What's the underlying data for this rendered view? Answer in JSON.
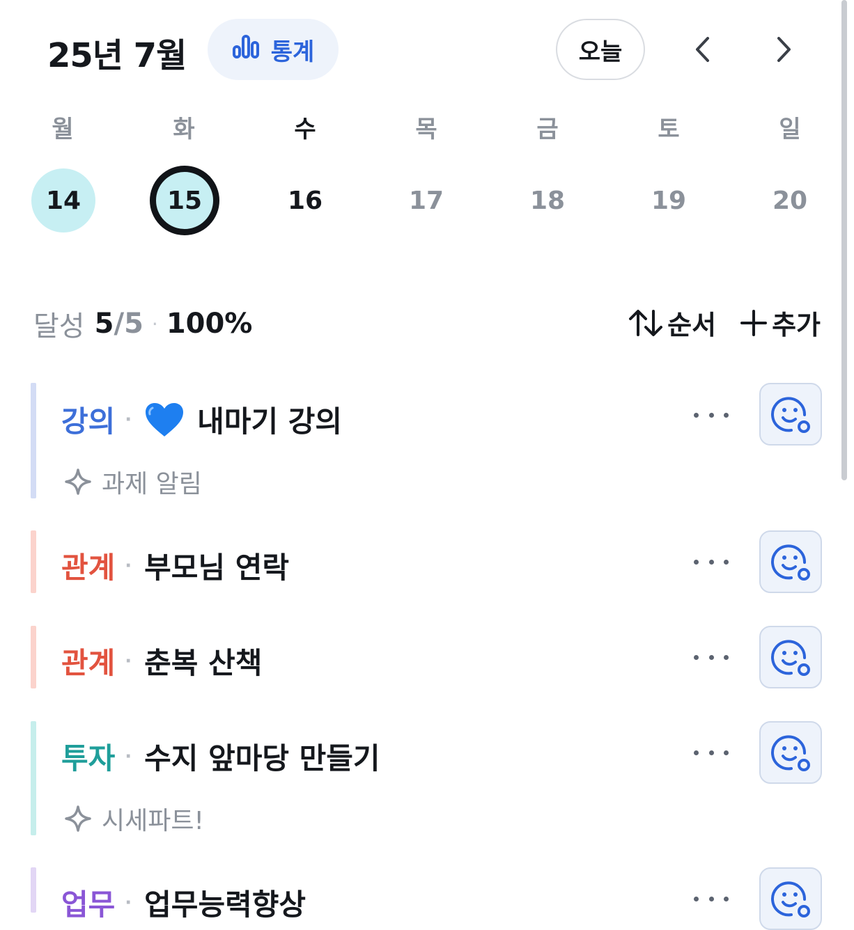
{
  "header": {
    "month_label": "25년 7월",
    "stats_label": "통계",
    "today_label": "오늘"
  },
  "calendar": {
    "weekdays": [
      "월",
      "화",
      "수",
      "목",
      "금",
      "토",
      "일"
    ],
    "dates": [
      "14",
      "15",
      "16",
      "17",
      "18",
      "19",
      "20"
    ]
  },
  "summary": {
    "label": "달성",
    "done": "5",
    "slash": "/",
    "total": "5",
    "separator": "·",
    "percent": "100%"
  },
  "toolbar": {
    "order_label": "순서",
    "add_label": "추가"
  },
  "tasks": [
    {
      "category": "강의",
      "separator": "·",
      "title": "내마기 강의",
      "note": "과제 알림",
      "color": "#3d6fd9",
      "bar_color": "#d3dcf5"
    },
    {
      "category": "관계",
      "separator": "·",
      "title": "부모님 연락",
      "color": "#e2533f",
      "bar_color": "#fbd3cc"
    },
    {
      "category": "관계",
      "separator": "·",
      "title": "춘복 산책",
      "color": "#e2533f",
      "bar_color": "#fbd3cc"
    },
    {
      "category": "투자",
      "separator": "·",
      "title": "수지 앞마당 만들기",
      "note": "시세파트!",
      "color": "#1f9e9a",
      "bar_color": "#c6eeec"
    },
    {
      "category": "업무",
      "separator": "·",
      "title": "업무능력향상",
      "color": "#8a56d6",
      "bar_color": "#e2d6f5"
    }
  ],
  "colors": {
    "accent_blue": "#2c64db",
    "date_fill": "#c7eff3",
    "face_button_bg": "#eef3fb"
  }
}
